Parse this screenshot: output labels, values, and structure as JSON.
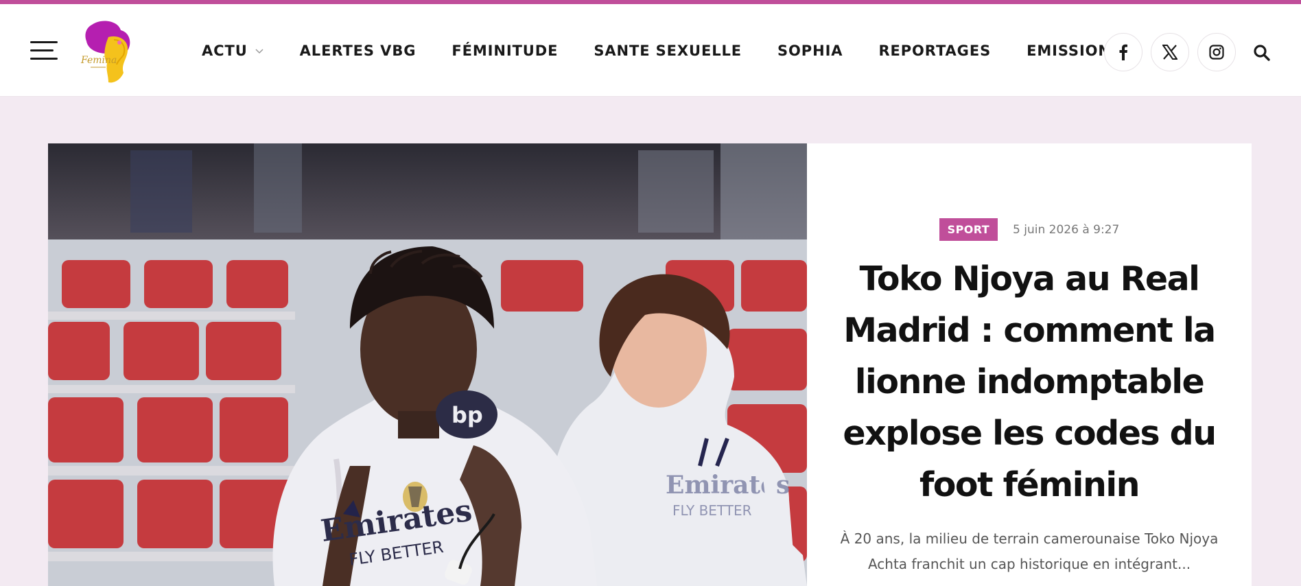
{
  "brand": {
    "accent": "#c04e9a",
    "logo_text": "Femina"
  },
  "header": {
    "nav": [
      {
        "label": "ACTU",
        "has_dropdown": true
      },
      {
        "label": "ALERTES VBG"
      },
      {
        "label": "FÉMINITUDE"
      },
      {
        "label": "SANTE SEXUELLE"
      },
      {
        "label": "SOPHIA"
      },
      {
        "label": "REPORTAGES"
      },
      {
        "label": "EMISSIONS"
      }
    ],
    "social": [
      "facebook-icon",
      "x-icon",
      "instagram-icon"
    ],
    "search_icon": "search-icon",
    "menu_icon": "hamburger-menu-icon"
  },
  "featured": {
    "category": "SPORT",
    "date": "5 juin 2026 à 9:27",
    "title": "Toko Njoya au Real Madrid : comment la lionne indomptable explose les codes du foot féminin",
    "excerpt": "À 20 ans, la milieu de terrain camerounaise Toko Njoya Achta franchit un cap historique en intégrant...",
    "image_text": {
      "sponsor": "Emirates",
      "slogan": "FLY BETTER",
      "sleeve_logo": "bp"
    }
  }
}
